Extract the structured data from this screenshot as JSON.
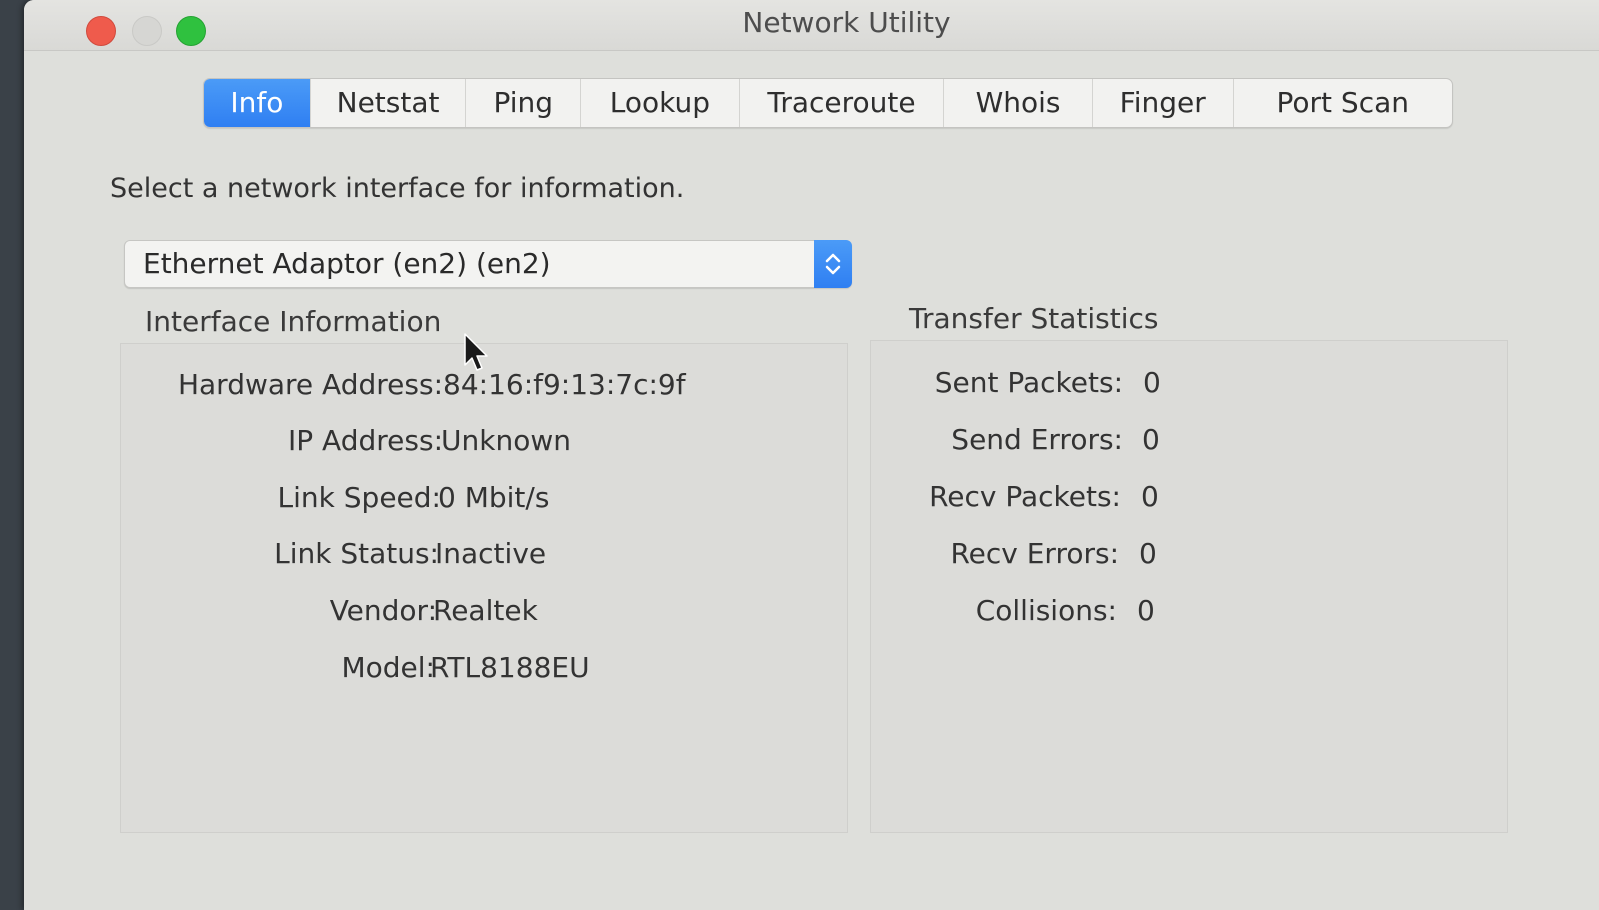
{
  "window": {
    "title": "Network Utility"
  },
  "tabs": [
    "Info",
    "Netstat",
    "Ping",
    "Lookup",
    "Traceroute",
    "Whois",
    "Finger",
    "Port Scan"
  ],
  "active_tab": "Info",
  "prompt": "Select a network interface for information.",
  "interface_select": {
    "value": "Ethernet Adaptor (en2) (en2)"
  },
  "interface_info": {
    "title": "Interface Information",
    "rows": [
      {
        "label": "Hardware Address:",
        "value": "84:16:f9:13:7c:9f"
      },
      {
        "label": "IP Address:",
        "value": "Unknown"
      },
      {
        "label": "Link Speed:",
        "value": "0 Mbit/s"
      },
      {
        "label": "Link Status:",
        "value": "Inactive"
      },
      {
        "label": "Vendor:",
        "value": "Realtek"
      },
      {
        "label": "Model:",
        "value": "RTL8188EU"
      }
    ]
  },
  "transfer_stats": {
    "title": "Transfer Statistics",
    "rows": [
      {
        "label": "Sent Packets:",
        "value": "0"
      },
      {
        "label": "Send Errors:",
        "value": "0"
      },
      {
        "label": "Recv Packets:",
        "value": "0"
      },
      {
        "label": "Recv Errors:",
        "value": "0"
      },
      {
        "label": "Collisions:",
        "value": "0"
      }
    ]
  },
  "colors": {
    "accent": "#3a8cf5",
    "close": "#ef5b4c",
    "zoom": "#2fc13f"
  }
}
